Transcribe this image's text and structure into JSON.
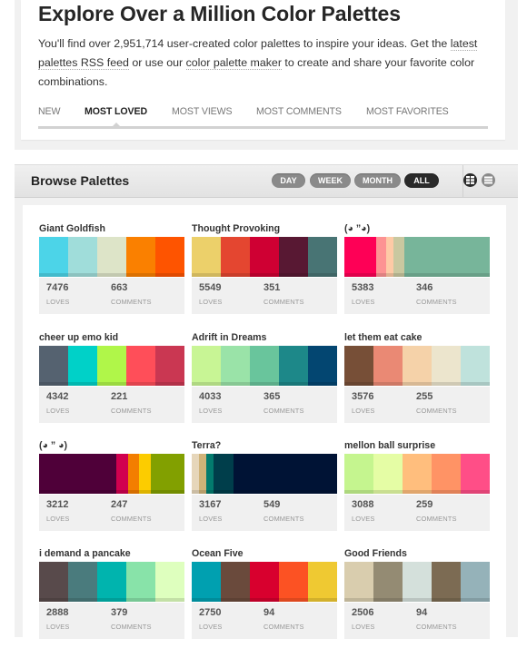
{
  "intro": {
    "title": "Explore Over a Million Color Palettes",
    "text_before": "You'll find over 2,951,714 user-created color palettes to inspire your ideas. Get the ",
    "link_rss": "latest palettes RSS feed",
    "text_middle": " or use our ",
    "link_maker": "color palette maker",
    "text_after": " to create and share your favorite color combinations.",
    "tabs": [
      {
        "label": "NEW",
        "active": false
      },
      {
        "label": "MOST LOVED",
        "active": true
      },
      {
        "label": "MOST VIEWS",
        "active": false
      },
      {
        "label": "MOST COMMENTS",
        "active": false
      },
      {
        "label": "MOST FAVORITES",
        "active": false
      }
    ]
  },
  "browse": {
    "title": "Browse Palettes",
    "filters": [
      {
        "label": "DAY",
        "active": false
      },
      {
        "label": "WEEK",
        "active": false
      },
      {
        "label": "MONTH",
        "active": false
      },
      {
        "label": "ALL",
        "active": true
      }
    ],
    "views": [
      {
        "icon": "grid-view-icon",
        "active": true
      },
      {
        "icon": "list-view-icon",
        "active": false
      }
    ],
    "loves_label": "LOVES",
    "comments_label": "COMMENTS",
    "palettes": [
      {
        "name": "Giant Goldfish",
        "loves": "7476",
        "comments": "663",
        "colors": [
          "#4CD4E8",
          "#A0DDDA",
          "#DDE4C8",
          "#FA8000",
          "#FE5400"
        ],
        "weights": [
          1,
          1,
          1,
          1,
          1
        ]
      },
      {
        "name": "Thought Provoking",
        "loves": "5549",
        "comments": "351",
        "colors": [
          "#ECD06A",
          "#E44630",
          "#CF0033",
          "#581833",
          "#487474"
        ],
        "weights": [
          1,
          1,
          1,
          1,
          1
        ]
      },
      {
        "name": "(◕ ”◕)",
        "loves": "5383",
        "comments": "346",
        "colors": [
          "#FE0056",
          "#FD9393",
          "#FECAA6",
          "#C9C8A0",
          "#77B59A"
        ],
        "weights": [
          22,
          7,
          5,
          7,
          59
        ]
      },
      {
        "name": "cheer up emo kid",
        "loves": "4342",
        "comments": "221",
        "colors": [
          "#556270",
          "#00D1C8",
          "#B0F649",
          "#FF4E59",
          "#CA3752"
        ],
        "weights": [
          1,
          1,
          1,
          1,
          1
        ]
      },
      {
        "name": "Adrift in Dreams",
        "loves": "4033",
        "comments": "365",
        "colors": [
          "#C8F595",
          "#9AE3A8",
          "#69C59C",
          "#1D8889",
          "#034671"
        ],
        "weights": [
          1,
          1,
          1,
          1,
          1
        ]
      },
      {
        "name": "let them eat cake",
        "loves": "3576",
        "comments": "255",
        "colors": [
          "#774F37",
          "#EA8974",
          "#F5D2A9",
          "#ECE5CD",
          "#BFE2DC"
        ],
        "weights": [
          1,
          1,
          1,
          1,
          1
        ]
      },
      {
        "name": "(◕ ” ◕)",
        "loves": "3212",
        "comments": "247",
        "colors": [
          "#4F0039",
          "#D1004F",
          "#F37E00",
          "#FCCC00",
          "#82A000"
        ],
        "weights": [
          53,
          8,
          8,
          8,
          23
        ]
      },
      {
        "name": "Terra?",
        "loves": "3167",
        "comments": "549",
        "colors": [
          "#E6D6BA",
          "#D0B378",
          "#037B6E",
          "#003E4B",
          "#001335"
        ],
        "weights": [
          5,
          5,
          5,
          14,
          71
        ]
      },
      {
        "name": "mellon ball surprise",
        "loves": "3088",
        "comments": "259",
        "colors": [
          "#C5F58F",
          "#E5FDA5",
          "#FFBE7D",
          "#FF9365",
          "#FF4E87"
        ],
        "weights": [
          1,
          1,
          1,
          1,
          1
        ]
      },
      {
        "name": "i demand a pancake",
        "loves": "2888",
        "comments": "379",
        "colors": [
          "#584A4B",
          "#4A7B7D",
          "#00B4AE",
          "#88E3A9",
          "#DEFFBE"
        ],
        "weights": [
          1,
          1,
          1,
          1,
          1
        ]
      },
      {
        "name": "Ocean Five",
        "loves": "2750",
        "comments": "94",
        "colors": [
          "#00A0B0",
          "#6A4A3C",
          "#D8002E",
          "#FC5223",
          "#EFC932"
        ],
        "weights": [
          1,
          1,
          1,
          1,
          1
        ]
      },
      {
        "name": "Good Friends",
        "loves": "2506",
        "comments": "94",
        "colors": [
          "#D9CDAE",
          "#948B73",
          "#D4E0DB",
          "#7C6B53",
          "#95B2B9"
        ],
        "weights": [
          1,
          1,
          1,
          1,
          1
        ]
      }
    ]
  }
}
